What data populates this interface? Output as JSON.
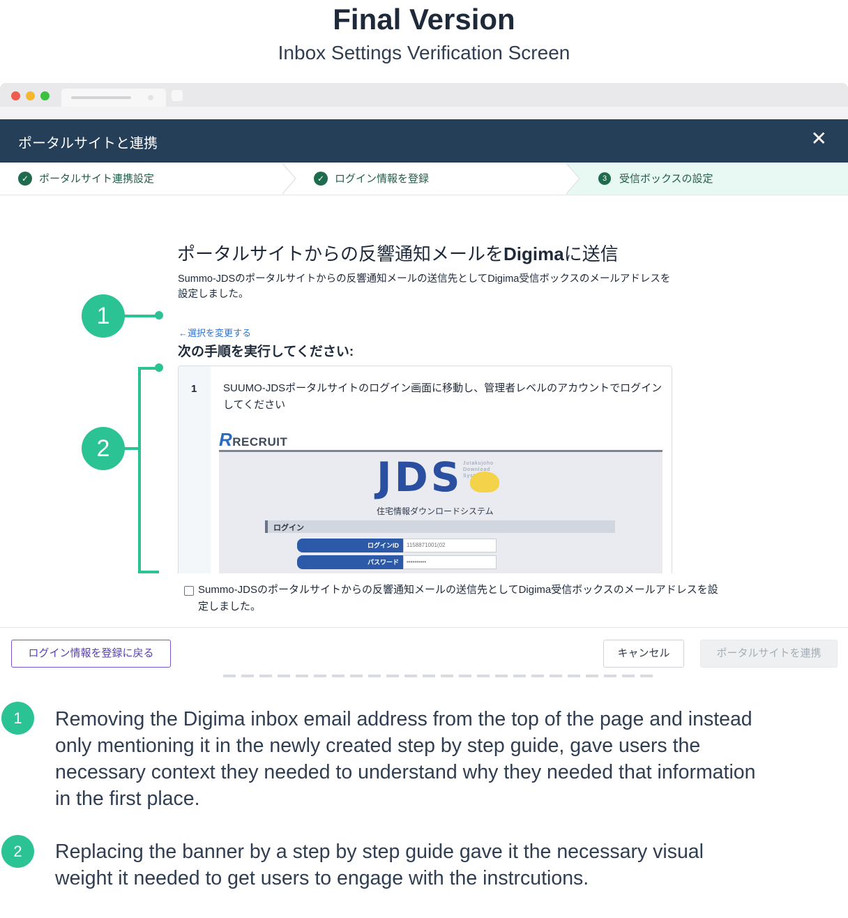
{
  "header": {
    "title": "Final Version",
    "subtitle": "Inbox Settings  Verification Screen"
  },
  "modal": {
    "title": "ポータルサイトと連携",
    "close_glyph": "✕"
  },
  "stepper": {
    "steps": [
      {
        "label": "ポータルサイト連携設定",
        "status": "done"
      },
      {
        "label": "ログイン情報を登録",
        "status": "done"
      },
      {
        "label": "受信ボックスの設定",
        "status": "active",
        "number": "3"
      }
    ],
    "check_glyph": "✓"
  },
  "content": {
    "heading_pre": "ポータルサイトからの反響通知メールを",
    "heading_brand": "Digima",
    "heading_post": "に送信",
    "description": "Summo-JDSのポータルサイトからの反響通知メールの送信先としてDigima受信ボックスのメールアドレスを設定しました。",
    "change_link": "←選択を変更する",
    "next_heading": "次の手順を実行してください:"
  },
  "guide": {
    "step_number": "1",
    "step_text": "SUUMO-JDSポータルサイトのログイン画面に移動し、管理者レベルのアカウントでログインしてください",
    "screenshot": {
      "logo_text": "RECRUIT",
      "logo_initial": "R",
      "jds_logo": "JDS",
      "jds_tagline": "Jutakujoho Download System",
      "jds_subtitle": "住宅情報ダウンロードシステム",
      "login_section": "ログイン",
      "login_id_label": "ログインID",
      "login_id_value": "1158871001(02",
      "password_label": "パスワード",
      "password_value": "••••••••••"
    }
  },
  "confirm": {
    "label": "Summo-JDSのポータルサイトからの反響通知メールの送信先としてDigima受信ボックスのメールアドレスを設定しました。"
  },
  "footer": {
    "back_label": "ログイン情報を登録に戻る",
    "cancel_label": "キャンセル",
    "connect_label": "ポータルサイトを連携"
  },
  "annotations": {
    "marker_1": "1",
    "marker_2": "2"
  },
  "notes": [
    {
      "number": "1",
      "text": "Removing the Digima inbox email address from the top of the page and instead only mentioning it in the newly created step by step guide, gave users the necessary context they needed to understand why they needed that information in the first place."
    },
    {
      "number": "2",
      "text": "Replacing the banner by a step by step guide gave it the necessary visual weight it needed to get users to engage with the instrcutions."
    }
  ],
  "colors": {
    "header_bg": "#263f58",
    "accent_green": "#2bc294",
    "step_green": "#1f6b4d",
    "link_blue": "#2a72d4",
    "back_purple": "#7a52c9"
  }
}
